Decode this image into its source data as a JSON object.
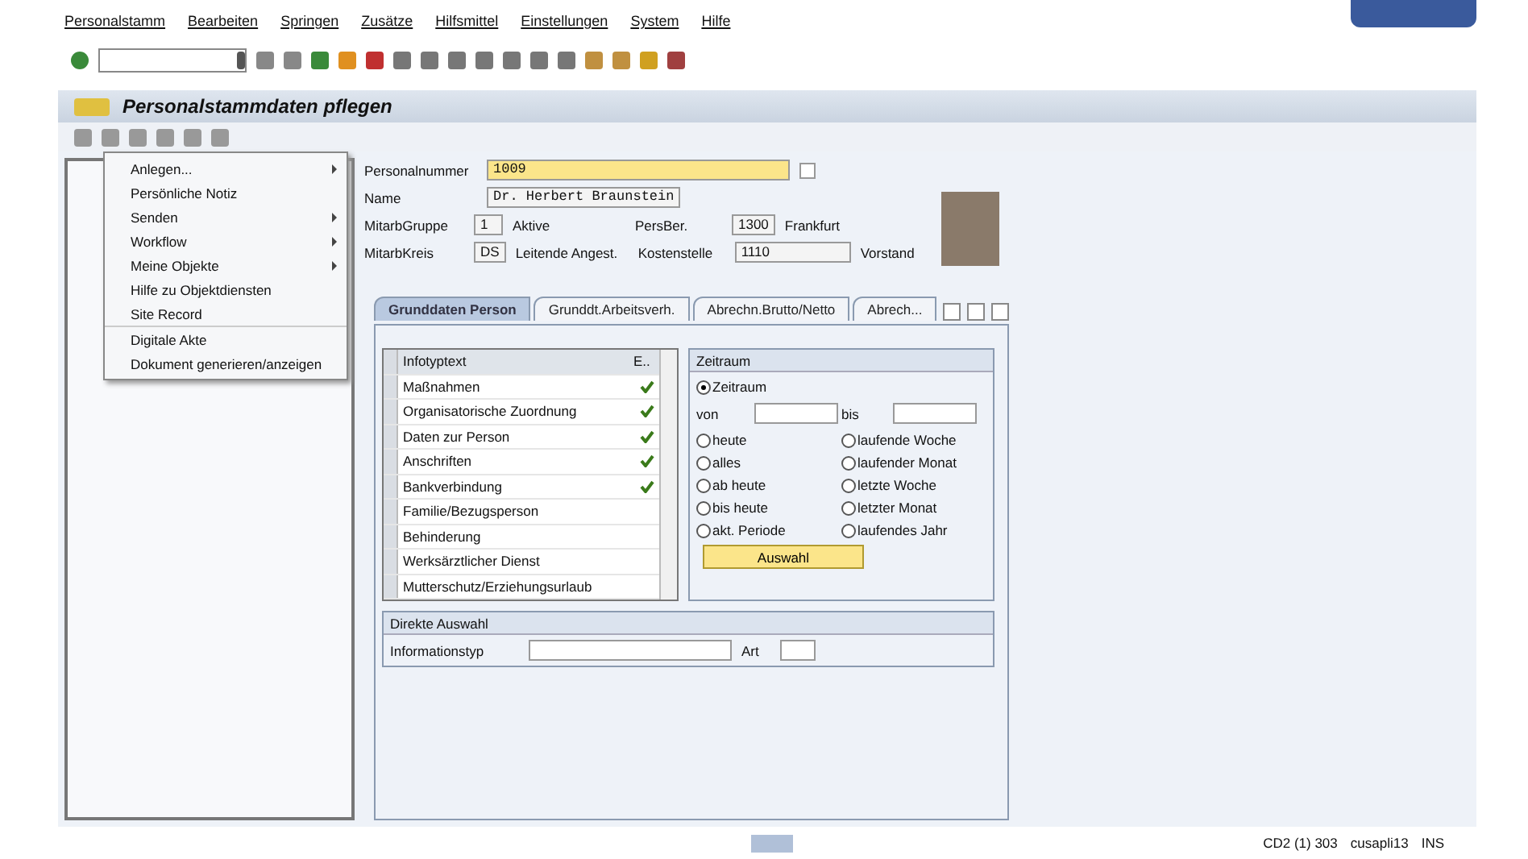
{
  "menu_bar": {
    "items": [
      "Personalstamm",
      "Bearbeiten",
      "Springen",
      "Zusätze",
      "Hilfsmittel",
      "Einstellungen",
      "System",
      "Hilfe"
    ]
  },
  "title_bar": {
    "title": "Personalstammdaten pflegen"
  },
  "object_services_menu": {
    "items": [
      {
        "label": "Anlegen...",
        "submenu": true,
        "separator_after": false
      },
      {
        "label": "Persönliche Notiz",
        "submenu": false,
        "separator_after": false
      },
      {
        "label": "Senden",
        "submenu": true,
        "separator_after": false
      },
      {
        "label": "Workflow",
        "submenu": true,
        "separator_after": false
      },
      {
        "label": "Meine Objekte",
        "submenu": true,
        "separator_after": false
      },
      {
        "label": "Hilfe zu Objektdiensten",
        "submenu": false,
        "separator_after": false
      },
      {
        "label": "Site Record",
        "submenu": false,
        "separator_after": true
      },
      {
        "label": "Digitale Akte",
        "submenu": false,
        "separator_after": false
      },
      {
        "label": "Dokument generieren/anzeigen",
        "submenu": false,
        "separator_after": false
      }
    ]
  },
  "header": {
    "personalnummer": {
      "label": "Personalnummer",
      "value": "1009"
    },
    "name": {
      "label": "Name",
      "value": "Dr. Herbert Braunstein"
    },
    "rows": [
      {
        "label": "MitarbGruppe",
        "code": "1",
        "text": "Aktive",
        "label2": "PersBer.",
        "code2": "1300",
        "text2": "Frankfurt"
      },
      {
        "label": "MitarbKreis",
        "code": "DS",
        "text": "Leitende Angest.",
        "label2": "Kostenstelle",
        "code2": "1110",
        "text2": "Vorstand"
      }
    ]
  },
  "tabs": [
    {
      "label": "Grunddaten Person",
      "selected": true
    },
    {
      "label": "Grunddt.Arbeitsverh.",
      "selected": false
    },
    {
      "label": "Abrechn.Brutto/Netto",
      "selected": false
    },
    {
      "label": "Abrech...",
      "selected": false
    }
  ],
  "infotype_table": {
    "columns": [
      "Infotyptext",
      "E.."
    ],
    "rows": [
      {
        "text": "Maßnahmen",
        "checked": true
      },
      {
        "text": "Organisatorische Zuordnung",
        "checked": true
      },
      {
        "text": "Daten zur Person",
        "checked": true
      },
      {
        "text": "Anschriften",
        "checked": true
      },
      {
        "text": "Bankverbindung",
        "checked": true
      },
      {
        "text": "Familie/Bezugsperson",
        "checked": false
      },
      {
        "text": "Behinderung",
        "checked": false
      },
      {
        "text": "Werksärztlicher Dienst",
        "checked": false
      },
      {
        "text": "Mutterschutz/Erziehungsurlaub",
        "checked": false
      }
    ]
  },
  "zeitraum": {
    "title": "Zeitraum",
    "main_option": {
      "label": "Zeitraum",
      "selected": true
    },
    "from_label": "von",
    "to_label": "bis",
    "options": [
      {
        "label": "heute",
        "selected": false
      },
      {
        "label": "laufende Woche",
        "selected": false
      },
      {
        "label": "alles",
        "selected": false
      },
      {
        "label": "laufender Monat",
        "selected": false
      },
      {
        "label": "ab heute",
        "selected": false
      },
      {
        "label": "letzte Woche",
        "selected": false
      },
      {
        "label": "bis heute",
        "selected": false
      },
      {
        "label": "letzter Monat",
        "selected": false
      },
      {
        "label": "akt. Periode",
        "selected": false
      },
      {
        "label": "laufendes Jahr",
        "selected": false
      }
    ],
    "button": "Auswahl"
  },
  "direkte_auswahl": {
    "title": "Direkte Auswahl",
    "infotyp_label": "Informationstyp",
    "art_label": "Art"
  },
  "status_bar": {
    "system": "CD2 (1) 303",
    "server": "cusapli13",
    "mode": "INS"
  }
}
